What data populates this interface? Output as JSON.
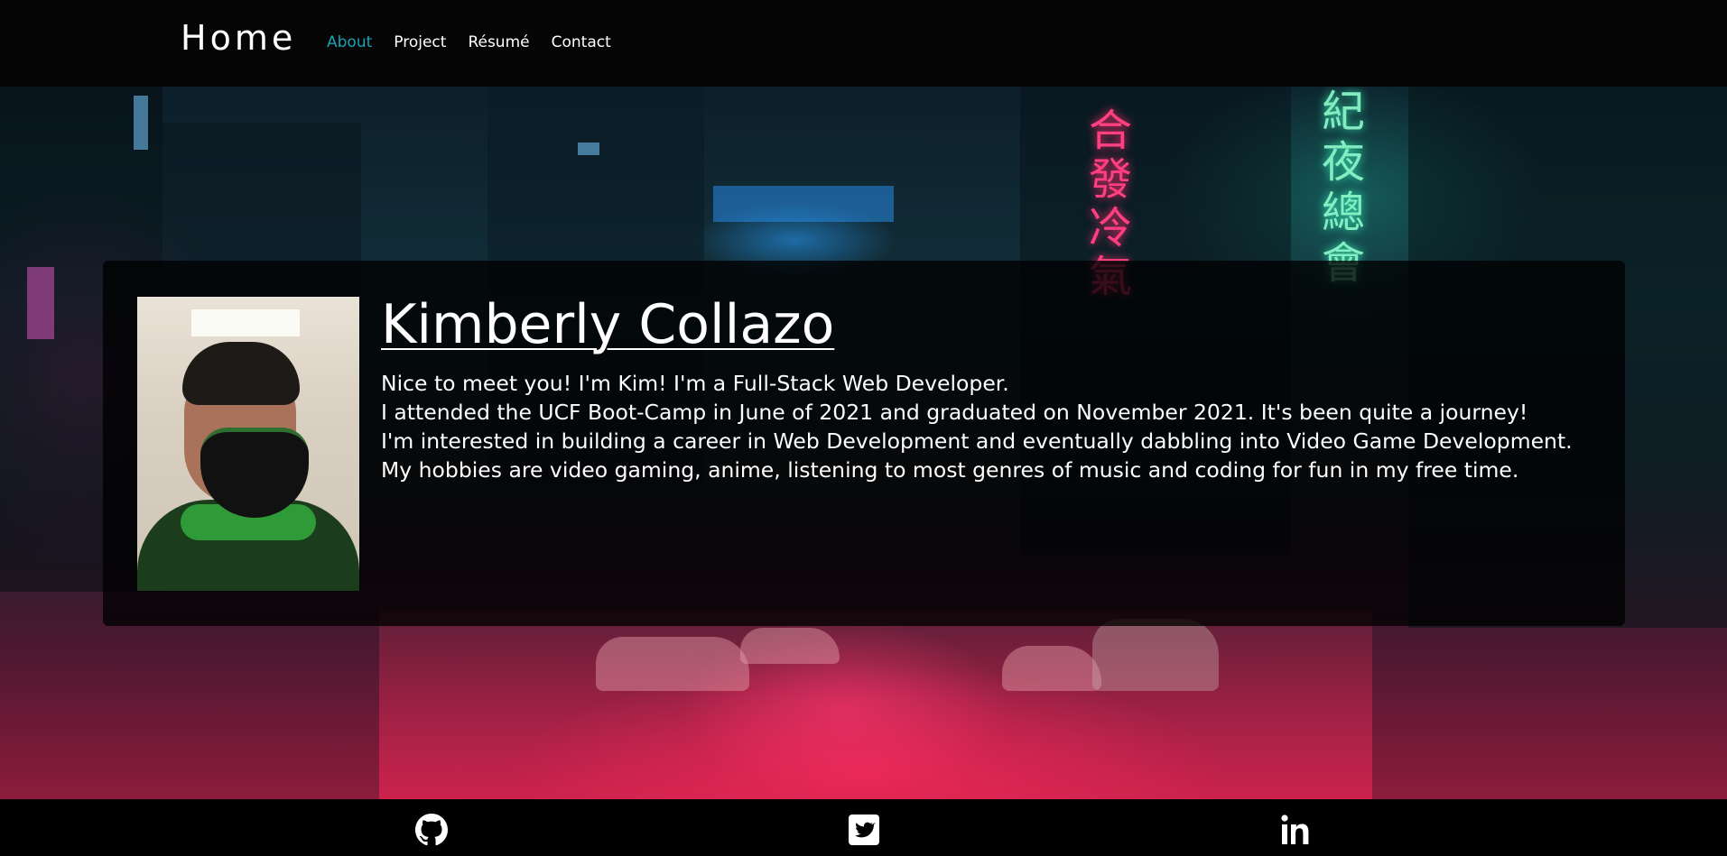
{
  "nav": {
    "brand": "Home",
    "links": [
      {
        "label": "About",
        "active": true
      },
      {
        "label": "Project",
        "active": false
      },
      {
        "label": "Résumé",
        "active": false
      },
      {
        "label": "Contact",
        "active": false
      }
    ]
  },
  "colors": {
    "accent": "#17a2b8",
    "navbar_bg": "#050505",
    "card_bg": "rgba(0,0,0,0.78)"
  },
  "hero": {
    "background_description": "cyberpunk neon city street at night",
    "profile_photo_alt": "Kimberly Collazo profile photo"
  },
  "about": {
    "name": "Kimberly Collazo",
    "bio": [
      "Nice to meet you! I'm Kim! I'm a Full-Stack Web Developer.",
      "I attended the UCF Boot-Camp in June of 2021 and graduated on November 2021. It's been quite a journey!",
      "I'm interested in building a career in Web Development and eventually dabbling into Video Game Development.",
      "My hobbies are video gaming, anime, listening to most genres of music and coding for fun in my free time."
    ]
  },
  "footer": {
    "icons": [
      "github-icon",
      "twitter-icon",
      "linkedin-icon"
    ]
  }
}
